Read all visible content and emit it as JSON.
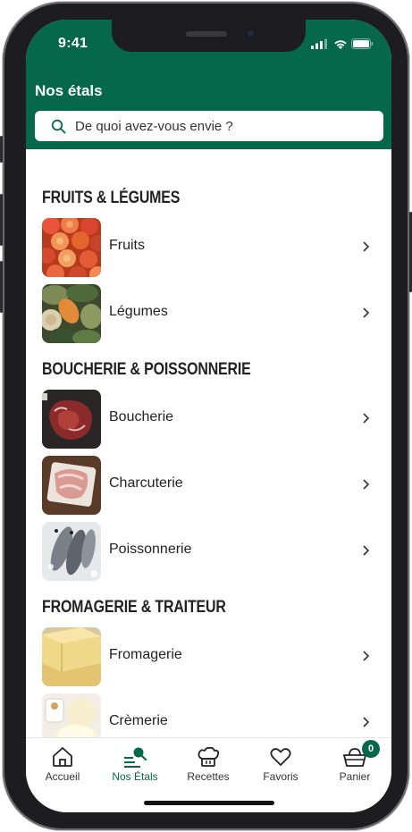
{
  "status_bar": {
    "time": "9:41"
  },
  "header": {
    "title": "Nos étals",
    "search_placeholder": "De quoi avez-vous envie ?"
  },
  "colors": {
    "brand": "#046849"
  },
  "sections": [
    {
      "title": "FRUITS & LÉGUMES",
      "items": [
        {
          "label": "Fruits"
        },
        {
          "label": "Légumes"
        }
      ]
    },
    {
      "title": "BOUCHERIE & POISSONNERIE",
      "items": [
        {
          "label": "Boucherie"
        },
        {
          "label": "Charcuterie"
        },
        {
          "label": "Poissonnerie"
        }
      ]
    },
    {
      "title": "FROMAGERIE & TRAITEUR",
      "items": [
        {
          "label": "Fromagerie"
        },
        {
          "label": "Crèmerie"
        }
      ]
    }
  ],
  "tabbar": {
    "tabs": [
      {
        "label": "Accueil",
        "icon": "home-icon"
      },
      {
        "label": "Nos Étals",
        "icon": "stalls-search-icon",
        "active": true
      },
      {
        "label": "Recettes",
        "icon": "chef-hat-icon"
      },
      {
        "label": "Favoris",
        "icon": "heart-icon"
      },
      {
        "label": "Panier",
        "icon": "basket-icon",
        "badge": "0"
      }
    ]
  }
}
